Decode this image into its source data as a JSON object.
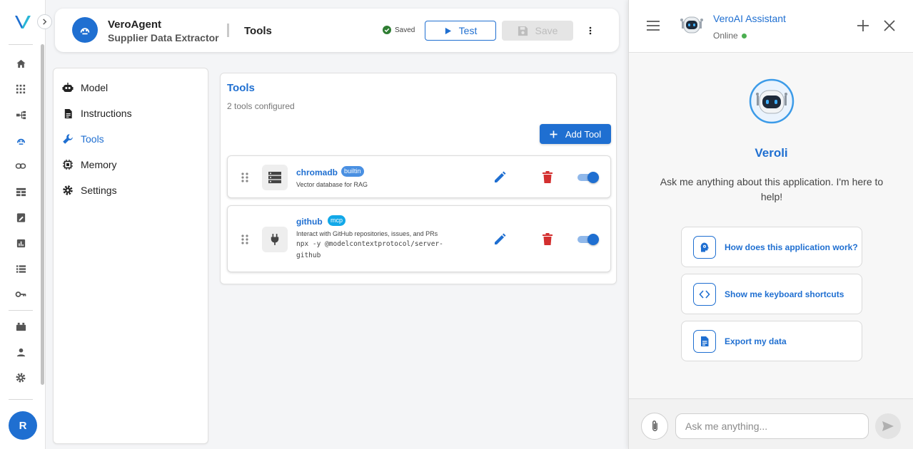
{
  "colors": {
    "accent": "#1f6fd1",
    "danger": "#d32f2f",
    "success": "#2e7d32",
    "online": "#4caf50"
  },
  "rail": {
    "logo_letter": "V",
    "items": [
      "home-icon",
      "apps-grid-icon",
      "workflow-icon",
      "agent-icon",
      "link-icon",
      "dashboard-icon",
      "edit-note-icon",
      "analytics-icon",
      "list-icon",
      "key-icon",
      "plugin-icon",
      "user-icon",
      "settings-icon"
    ],
    "avatar_initial": "R"
  },
  "header": {
    "agent_name": "VeroAgent",
    "agent_subtitle": "Supplier Data Extractor",
    "section": "Tools",
    "saved_label": "Saved",
    "test_label": "Test",
    "save_label": "Save"
  },
  "nav": {
    "items": [
      {
        "label": "Model",
        "icon": "robot-icon"
      },
      {
        "label": "Instructions",
        "icon": "document-icon"
      },
      {
        "label": "Tools",
        "icon": "wrench-icon",
        "active": true
      },
      {
        "label": "Memory",
        "icon": "chip-icon"
      },
      {
        "label": "Settings",
        "icon": "gear-icon"
      }
    ]
  },
  "tools_panel": {
    "title": "Tools",
    "subtitle": "2 tools configured",
    "add_label": "Add Tool",
    "tools": [
      {
        "name": "chromadb",
        "badge": "builtin",
        "badge_color": "#4a90e2",
        "description": "Vector database for RAG",
        "command": "",
        "enabled": true,
        "icon": "database-icon"
      },
      {
        "name": "github",
        "badge": "mcp",
        "badge_color": "#12a8e8",
        "description": "Interact with GitHub repositories, issues, and PRs",
        "command": "npx -y @modelcontextprotocol/server-github",
        "enabled": true,
        "icon": "plug-icon"
      }
    ]
  },
  "assistant": {
    "name": "VeroAI Assistant",
    "status": "Online",
    "bot_name": "Veroli",
    "welcome": "Ask me anything about this application. I'm here to help!",
    "suggestions": [
      {
        "label": "How does this application work?",
        "icon": "lightbulb-head-icon"
      },
      {
        "label": "Show me keyboard shortcuts",
        "icon": "code-brackets-icon"
      },
      {
        "label": "Export my data",
        "icon": "file-export-icon"
      }
    ],
    "input_placeholder": "Ask me anything..."
  }
}
